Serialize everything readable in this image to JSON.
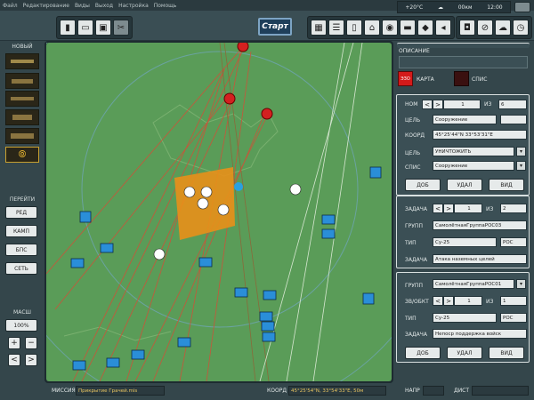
{
  "menu": [
    "Файл",
    "Редактирование",
    "Виды",
    "Выход",
    "Настройка",
    "Помощь"
  ],
  "toolbar": {
    "start_label": "Старт"
  },
  "status": {
    "temperature": "+20°C",
    "wind": "00км",
    "time": "12:00"
  },
  "sidebar": {
    "new_label": "НОВЫЙ",
    "goto_label": "ПЕРЕЙТИ",
    "nav": [
      "РЕД",
      "КАМП",
      "БПС",
      "СЕТЬ"
    ],
    "zoom_label": "МАСШ",
    "zoom_value": "100%",
    "plus": "+",
    "minus": "−",
    "left": "<",
    "right": ">"
  },
  "right": {
    "description_label": "ОПИСАНИЕ",
    "map_tab": "КАРТА",
    "map_icon": "ЭЗО",
    "list_tab": "СПИС",
    "target": {
      "num_label": "НОМ",
      "num_value": "1",
      "of_label": "ИЗ",
      "of_value": "6",
      "goal_label": "ЦЕЛЬ",
      "goal_value": "Сооружение",
      "coord_label": "КООРД",
      "coord_value": "45°25'44\"N 33°53'31\"E",
      "goal2_label": "ЦЕЛЬ",
      "goal2_value": "УНИЧТОЖИТЬ",
      "method_label": "СПИС",
      "method_value": "Сооружение",
      "add": "ДОБ",
      "del": "УДАЛ",
      "view": "ВИД"
    },
    "task": {
      "task_label": "ЗАДАЧА",
      "task_value": "1",
      "of_label": "ИЗ",
      "of_value": "2",
      "group_label": "ГРУПП",
      "group_value": "СамолётнаяГруппаРОС03",
      "type_label": "ТИП",
      "type_value": "Су-25",
      "side_value": "РОС",
      "task2_label": "ЗАДАЧА",
      "task2_value": "Атака наземных целей"
    },
    "group": {
      "group_label": "ГРУПП",
      "group_value": "СамолётнаяГруппаРОС01",
      "count_label": "ЗВ/ОБКТ",
      "count_value": "1",
      "of_label": "ИЗ",
      "of_value": "1",
      "type_label": "ТИП",
      "type_value": "Су-25",
      "side_value": "РОС",
      "task_label": "ЗАДАЧА",
      "task_value": "Непоср поддержка войск",
      "add": "ДОБ",
      "del": "УДАЛ",
      "view": "ВИД"
    }
  },
  "bottom": {
    "mission_label": "МИССИЯ",
    "mission_value": "Прикрытие Грачей.mis",
    "coord_label": "КООРД",
    "coord_value": "45°25'54\"N, 33°54'33\"E, 50м",
    "dir_label": "НАПР",
    "dist_label": "ДИСТ"
  }
}
